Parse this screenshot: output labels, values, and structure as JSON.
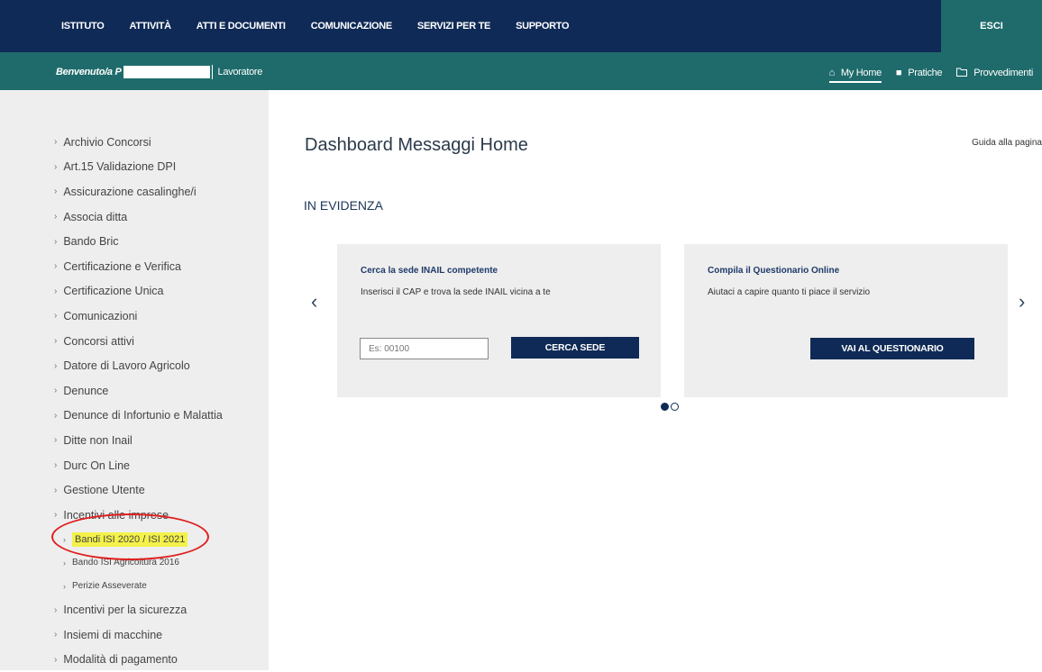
{
  "topnav": {
    "items": [
      "ISTITUTO",
      "ATTIVITÀ",
      "ATTI E DOCUMENTI",
      "COMUNICAZIONE",
      "SERVIZI PER TE",
      "SUPPORTO"
    ],
    "logout": "ESCI"
  },
  "welcome": {
    "greeting": "Benvenuto/a P",
    "role": "Lavoratore"
  },
  "rightnav": {
    "home": "My Home",
    "practices": "Pratiche",
    "measures": "Provvedimenti"
  },
  "sidebar": {
    "items": [
      "Archivio Concorsi",
      "Art.15 Validazione DPI",
      "Assicurazione casalinghe/i",
      "Associa ditta",
      "Bando Bric",
      "Certificazione e Verifica",
      "Certificazione Unica",
      "Comunicazioni",
      "Concorsi attivi",
      "Datore di Lavoro Agricolo",
      "Denunce",
      "Denunce di Infortunio e Malattia",
      "Ditte non Inail",
      "Durc On Line",
      "Gestione Utente",
      "Incentivi alle imprese"
    ],
    "subitems": [
      "Bandi ISI 2020 / ISI 2021",
      "Bando ISI Agricoltura 2016",
      "Perizie Asseverate"
    ],
    "items_after": [
      "Incentivi per la sicurezza",
      "Insiemi di macchine",
      "Modalità di pagamento"
    ]
  },
  "main": {
    "title": "Dashboard Messaggi Home",
    "guide": "Guida alla pagina",
    "section": "IN EVIDENZA"
  },
  "cards": [
    {
      "title": "Cerca la sede INAIL competente",
      "text": "Inserisci il CAP e trova la sede INAIL vicina a te",
      "input_placeholder": "Es: 00100",
      "button": "CERCA SEDE"
    },
    {
      "title": "Compila il Questionario Online",
      "text": "Aiutaci a capire quanto ti piace il servizio",
      "button": "VAI AL QUESTIONARIO"
    }
  ],
  "carousel": {
    "current": 1,
    "total": 2
  },
  "colors": {
    "navy": "#0f2a56",
    "teal": "#1f6b6b",
    "highlight": "#f4f24a",
    "annotation": "#e02020"
  }
}
